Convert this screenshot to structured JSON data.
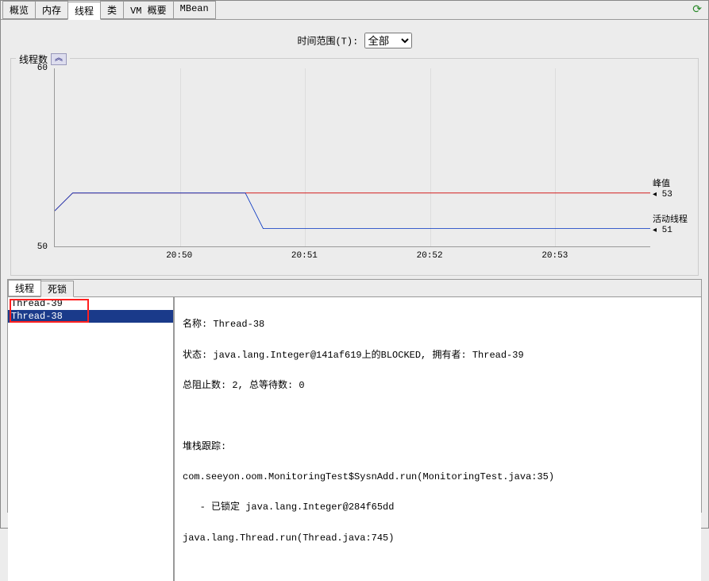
{
  "tabs": {
    "top": [
      "概览",
      "内存",
      "线程",
      "类",
      "VM 概要",
      "MBean"
    ],
    "active_top": 2,
    "sub": [
      "线程",
      "死锁"
    ],
    "active_sub": 1
  },
  "time_range": {
    "label": "时间范围(T):",
    "selected": "全部"
  },
  "chart": {
    "title": "线程数",
    "collapse_glyph": "︽"
  },
  "chart_data": {
    "type": "line",
    "xlabel": "",
    "ylabel": "",
    "ylim": [
      50,
      60
    ],
    "y_ticks": [
      50,
      60
    ],
    "x_ticks": [
      "20:50",
      "20:51",
      "20:52",
      "20:53"
    ],
    "series": [
      {
        "name": "峰值",
        "current": 53,
        "color": "#d00000",
        "points": [
          [
            0,
            52
          ],
          [
            3,
            53
          ],
          [
            100,
            53
          ]
        ]
      },
      {
        "name": "活动线程",
        "current": 51,
        "color": "#0030c0",
        "points": [
          [
            0,
            52
          ],
          [
            3,
            53
          ],
          [
            32,
            53
          ],
          [
            35,
            51
          ],
          [
            100,
            51
          ]
        ]
      }
    ]
  },
  "threads": {
    "list": [
      "Thread-39",
      "Thread-38"
    ],
    "selected_index": 1
  },
  "detail": {
    "name_label": "名称:",
    "name_value": "Thread-38",
    "state_label": "状态:",
    "state_value": "java.lang.Integer@141af619上的BLOCKED, 拥有者: Thread-39",
    "blocked_label": "总阻止数:",
    "blocked_value": "2,",
    "waited_label": "总等待数:",
    "waited_value": "0",
    "stack_label": "堆栈跟踪:",
    "stack": [
      "com.seeyon.oom.MonitoringTest$SysnAdd.run(MonitoringTest.java:35)",
      "   - 已锁定 java.lang.Integer@284f65dd",
      "java.lang.Thread.run(Thread.java:745)"
    ]
  },
  "watermark": ""
}
